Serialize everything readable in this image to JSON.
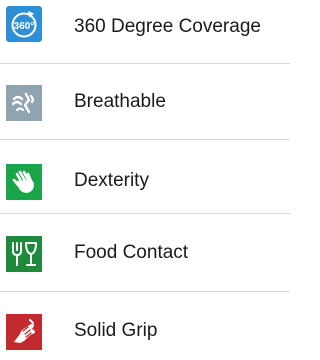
{
  "features": [
    {
      "label": "360 Degree Coverage",
      "icon": "360-coverage-icon",
      "icon_text": "360°",
      "color": "#2e8fd6"
    },
    {
      "label": "Breathable",
      "icon": "breathable-icon",
      "color": "#8fa3b1"
    },
    {
      "label": "Dexterity",
      "icon": "dexterity-hand-icon",
      "color": "#1aa54a"
    },
    {
      "label": "Food Contact",
      "icon": "food-contact-icon",
      "color": "#1f8a3b"
    },
    {
      "label": "Solid Grip",
      "icon": "solid-grip-icon",
      "color": "#c22a2f"
    }
  ]
}
